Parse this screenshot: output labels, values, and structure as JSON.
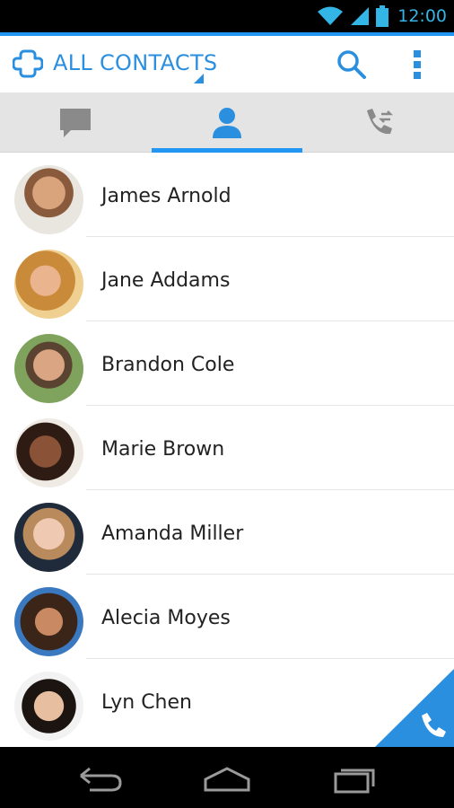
{
  "status_bar": {
    "time": "12:00",
    "accent_color": "#33b5e5",
    "icons": [
      "wifi-icon",
      "signal-icon",
      "battery-icon"
    ]
  },
  "app_bar": {
    "title": "ALL CONTACTS",
    "accent_color": "#2196f3",
    "actions": [
      "search-icon",
      "overflow-menu-icon"
    ]
  },
  "tabs": [
    {
      "name": "messages",
      "icon": "chat-bubble-icon",
      "active": false
    },
    {
      "name": "contacts",
      "icon": "person-icon",
      "active": true
    },
    {
      "name": "call-log",
      "icon": "phone-transfer-icon",
      "active": false
    }
  ],
  "contacts": [
    {
      "name": "James Arnold",
      "avatar": "photo"
    },
    {
      "name": "Jane Addams",
      "avatar": "photo"
    },
    {
      "name": "Brandon Cole",
      "avatar": "photo"
    },
    {
      "name": "Marie Brown",
      "avatar": "photo"
    },
    {
      "name": "Amanda Miller",
      "avatar": "photo"
    },
    {
      "name": "Alecia Moyes",
      "avatar": "photo"
    },
    {
      "name": "Lyn Chen",
      "avatar": "photo"
    }
  ],
  "fab": {
    "icon": "phone-icon",
    "color": "#2196f3"
  },
  "nav_bar": {
    "buttons": [
      "back-icon",
      "home-icon",
      "recents-icon"
    ]
  }
}
